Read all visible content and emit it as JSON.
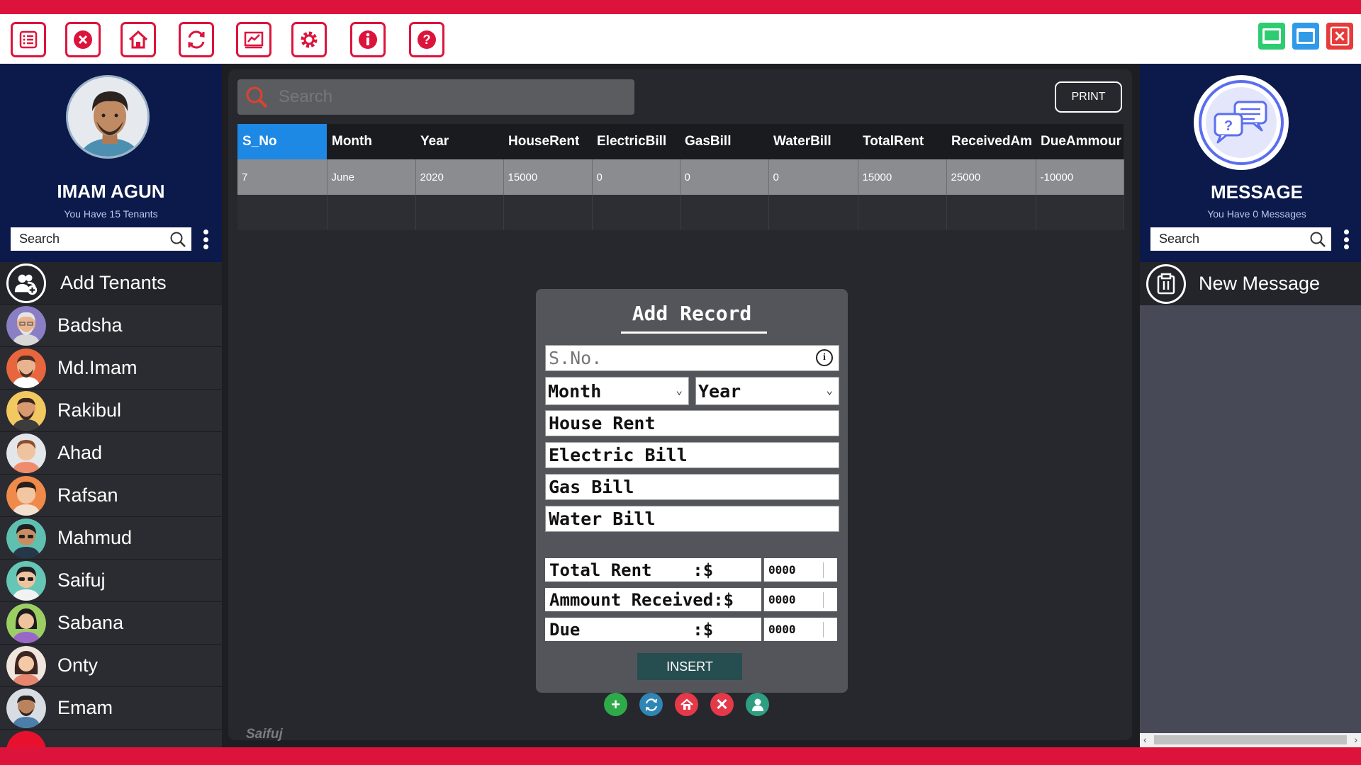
{
  "app": {
    "toolbar_icons": [
      "list-icon",
      "close-circle-icon",
      "home-icon",
      "refresh-icon",
      "report-icon",
      "settings-icon",
      "info-icon",
      "help-icon"
    ],
    "window_controls": [
      "minimize-icon",
      "maximize-icon",
      "close-icon"
    ],
    "colors": {
      "accent": "#dc143c",
      "sidebar": "#0b1a4b",
      "table_header_active": "#1e88e5",
      "insert_button": "#264d4f"
    }
  },
  "left": {
    "user_name": "IMAM AGUN",
    "tenant_count_text": "You Have 15 Tenants",
    "search_placeholder": "Search",
    "add_label": "Add Tenants",
    "tenants": [
      "Badsha",
      "Md.Imam",
      "Rakibul",
      "Ahad",
      "Rafsan",
      "Mahmud",
      "Saifuj",
      "Sabana",
      "Onty",
      "Emam"
    ]
  },
  "main": {
    "search_placeholder": "Search",
    "print_label": "PRINT",
    "columns": [
      "S_No",
      "Month",
      "Year",
      "HouseRent",
      "ElectricBill",
      "GasBill",
      "WaterBill",
      "TotalRent",
      "ReceivedAm",
      "DueAmmour"
    ],
    "rows": [
      [
        "7",
        "June",
        "2020",
        "15000",
        "0",
        "0",
        "0",
        "15000",
        "25000",
        "-10000"
      ]
    ],
    "signature": "Saifuj"
  },
  "dialog": {
    "title": "Add Record",
    "sno_placeholder": "S.No.",
    "month_label": "Month",
    "year_label": "Year",
    "house_rent": "House Rent",
    "electric_bill": "Electric Bill",
    "gas_bill": "Gas Bill",
    "water_bill": "Water Bill",
    "total_rent_label": "Total Rent    :$",
    "amount_received_label": "Ammount Received:$",
    "due_label": "Due           :$",
    "total_rent_value": "0000",
    "amount_received_value": "0000",
    "due_value": "0000",
    "insert_label": "INSERT"
  },
  "right": {
    "title": "MESSAGE",
    "message_count_text": "You Have 0 Messages",
    "search_placeholder": "Search",
    "new_message_label": "New Message"
  }
}
